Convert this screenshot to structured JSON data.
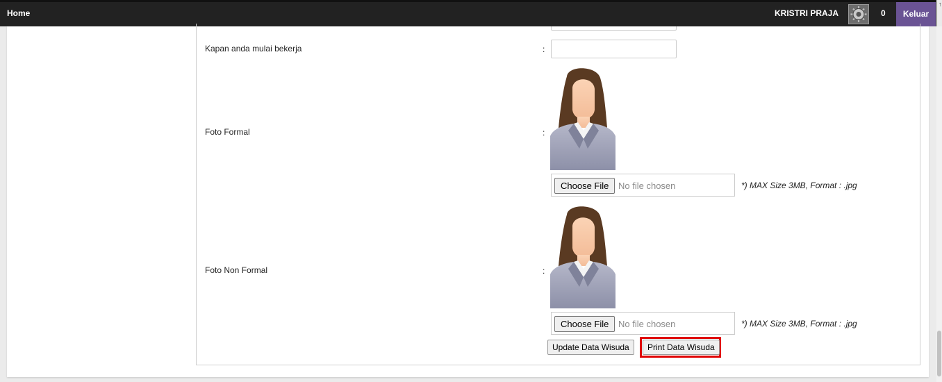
{
  "nav": {
    "home_label": "Home",
    "user_name": "KRISTRI PRAJA",
    "notification_count": "0",
    "logout_label": "Keluar",
    "logout_color": "#6a5394"
  },
  "form": {
    "rows": [
      {
        "label": "Kapan anda mulai bekerja",
        "colon": ":"
      },
      {
        "label": "Foto Formal",
        "colon": ":"
      },
      {
        "label": "Foto Non Formal",
        "colon": ":"
      }
    ],
    "photo_formal": {
      "choose_label": "Choose File",
      "status": "No file chosen",
      "hint": "*) MAX Size 3MB, Format : .jpg"
    },
    "photo_nonformal": {
      "choose_label": "Choose File",
      "status": "No file chosen",
      "hint": "*) MAX Size 3MB, Format : .jpg"
    },
    "update_label": "Update Data Wisuda",
    "print_label": "Print Data Wisuda",
    "highlight_color": "#e00000"
  }
}
